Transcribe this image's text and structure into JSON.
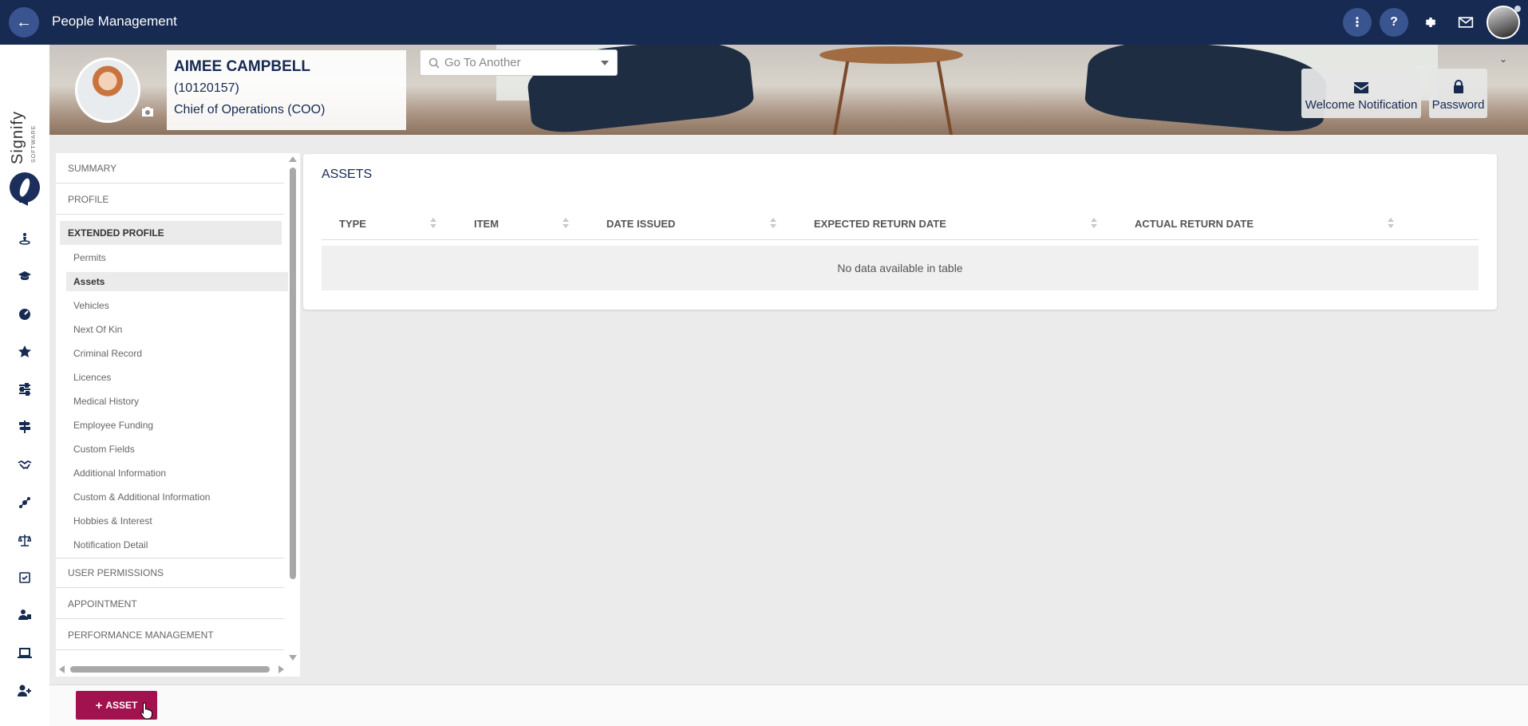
{
  "app": {
    "title": "People Management",
    "back_glyph": "←"
  },
  "topbar": {
    "more_glyph": "⋮",
    "help_glyph": "?",
    "icons": [
      "settings-gear-icon",
      "messages-icon",
      "user-avatar"
    ]
  },
  "brand": {
    "name": "Signify",
    "sub": "SOFTWARE"
  },
  "profile": {
    "name": "AIMEE CAMPBELL",
    "employee_number": "(10120157)",
    "position": "Chief of Operations (COO)"
  },
  "search": {
    "placeholder": "Go To Another"
  },
  "banner_buttons": {
    "welcome": "Welcome Notification",
    "password": "Password"
  },
  "menu": {
    "summary": "SUMMARY",
    "profile": "PROFILE",
    "extended_profile": "EXTENDED PROFILE",
    "subitems": [
      "Permits",
      "Assets",
      "Vehicles",
      "Next Of Kin",
      "Criminal Record",
      "Licences",
      "Medical History",
      "Employee Funding",
      "Custom Fields",
      "Additional Information",
      "Custom & Additional Information",
      "Hobbies & Interest",
      "Notification Detail"
    ],
    "active_subitem": "Assets",
    "user_permissions": "USER PERMISSIONS",
    "appointment": "APPOINTMENT",
    "performance_management": "PERFORMANCE MANAGEMENT"
  },
  "assets": {
    "title": "ASSETS",
    "columns": [
      "TYPE",
      "ITEM",
      "DATE ISSUED",
      "EXPECTED RETURN DATE",
      "ACTUAL RETURN DATE"
    ],
    "empty_message": "No data available in table"
  },
  "footer": {
    "add_label": "ASSET",
    "add_glyph": "+"
  },
  "colors": {
    "navy": "#162a52",
    "accent": "#a2124f",
    "circle": "#3a5490"
  }
}
